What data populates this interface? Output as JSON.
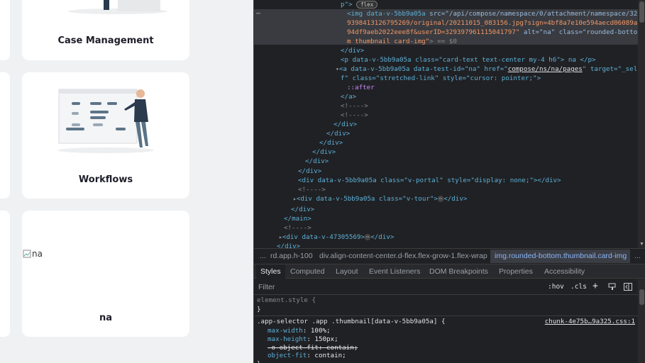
{
  "cards": [
    {
      "title": "Case Management"
    },
    {
      "title": "Workflows"
    },
    {
      "title": "na",
      "broken_img_alt": "na"
    }
  ],
  "elements": {
    "line0_text": "p\">",
    "line0_badge": "flex",
    "img_open": "<img data-v-5bb9a05a",
    "img_src_attr": " src=\"/api/compose/namespace/0/attachment/namespace/32",
    "img_src_2": "9398413126795269/original/20211015_083156.jpg?sign=4bf8a7e10e594aecd06089a",
    "img_src_3": "94df9aeb2022eee8f&userID=329397961115041797\"",
    "img_alt": " alt=\"na\" class=\"rounded-botto",
    "img_class_end": "m thumbnail card-img\"",
    "img_eq": "> == $0",
    "l_div_close1": "</div>",
    "p_line": "<p data-v-5bb9a05a class=\"card-text text-center my-4 h6\"> na </p>",
    "a_line_1": "<a data-v-5bb9a05a data-test-id=\"na\" href=\"",
    "a_href": "compose/ns/na/pages",
    "a_line_1b": "\" target=\"_sel",
    "a_line_2": "f\" class=\"stretched-link\" style=\"cursor: pointer;\">",
    "after": "::after",
    "a_close": "</a>",
    "comment": "<!---->",
    "div_close": "</div>",
    "portal": "<div data-v-5bb9a05a class=\"v-portal\" style=\"display: none;\"></div>",
    "comment2": "<!---->",
    "tour_open": "<div data-v-5bb9a05a class=\"v-tour\">",
    "tour_close": "</div>",
    "main_close": "</main>",
    "comment3": "<!---->",
    "div473": "<div data-v-47305569>",
    "div473_close": "</div>",
    "div_last": "</div>"
  },
  "breadcrumbs": {
    "ellipsis": "...",
    "item1": "rd.app.h-100",
    "item2": "div.align-content-center.d-flex.flex-grow-1.flex-wrap",
    "item3": "img.rounded-bottom.thumbnail.card-img",
    "more": "..."
  },
  "tabs": [
    "Styles",
    "Computed",
    "Layout",
    "Event Listeners",
    "DOM Breakpoints",
    "Properties",
    "Accessibility"
  ],
  "filter": {
    "placeholder": "Filter",
    "hov": ":hov",
    "cls": ".cls",
    "plus": "+"
  },
  "styles": {
    "element_style": "element.style {",
    "close_brace": "}",
    "selector": ".app-selector .app .thumbnail[data-v-5bb9a05a] {",
    "source": "chunk-4e75b…9a325.css:1",
    "props": [
      {
        "name": "max-width",
        "value": "100%;",
        "struck": false
      },
      {
        "name": "max-height",
        "value": "150px;",
        "struck": false
      },
      {
        "name": "-o-object-fit",
        "value": "contain;",
        "struck": true
      },
      {
        "name": "object-fit",
        "value": "contain;",
        "struck": false
      }
    ]
  },
  "colors": {
    "accent_link": "#8ab4f8",
    "tag": "#5db0d7",
    "attr_value": "#f29766"
  }
}
